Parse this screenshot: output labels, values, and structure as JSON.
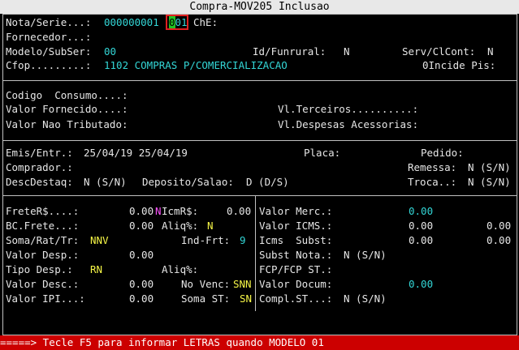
{
  "window": {
    "title": "Compra-MOV205  Inclusao"
  },
  "header": {
    "nota_serie_label": "Nota/Serie...:",
    "nota_value": "000000001",
    "serie_cursor_char": "0",
    "serie_rest": "01",
    "che_label": "ChE:",
    "fornecedor_label": "Fornecedor...:",
    "modelo_label": "Modelo/SubSer:",
    "modelo_value": "00",
    "idfunrural_label": "Id/Funrural:",
    "idfunrural_value": "N",
    "servclcont_label": "Serv/ClCont:",
    "servclcont_value": "N",
    "cfop_label": "Cfop.........:",
    "cfop_value": "1102 COMPRAS P/COMERCIALIZACAO",
    "incide_pis_label": "0Incide Pis:"
  },
  "values_section": {
    "codigo_consumo_label": "Codigo  Consumo....:",
    "valor_fornecido_label": "Valor Fornecido....:",
    "vl_terceiros_label": "Vl.Terceiros..........:",
    "valor_nao_tributado_label": "Valor Nao Tributado:",
    "vl_despesas_label": "Vl.Despesas Acessorias:"
  },
  "dates_section": {
    "emis_entr_label": "Emis/Entr.:",
    "emis_entr_value": "25/04/19 25/04/19",
    "placa_label": "Placa:",
    "pedido_label": "Pedido:",
    "comprador_label": "Comprador.:",
    "remessa_label": "Remessa:",
    "remessa_value": "N (S/N)",
    "descdestaq_label": "DescDestaq:",
    "descdestaq_value": "N (S/N)",
    "deposito_label": "Deposito/Salao:",
    "deposito_value": "D (D/S)",
    "troca_label": "Troca..:",
    "troca_value": "N (S/N)"
  },
  "left_panel": {
    "frete_label": "FreteR$....:",
    "frete_value": "0.00",
    "frete_flag": "N",
    "icmr_label": "IcmR$:",
    "icmr_value": "0.00",
    "bcfrete_label": "BC.Frete...:",
    "bcfrete_value": "0.00",
    "aliq_label": "Aliq%:",
    "aliq_value": "N",
    "soma_label": "Soma/Rat/Tr:",
    "soma_value": "NNV",
    "indfrt_label": "Ind-Frt:",
    "indfrt_value": "9",
    "valor_desp_label": "Valor Desp.:",
    "valor_desp_value": "0.00",
    "tipo_desp_label": "Tipo Desp.:",
    "tipo_desp_value": "RN",
    "aliq2_label": "Aliq%:",
    "valor_desc_label": "Valor Desc.:",
    "valor_desc_value": "0.00",
    "novenc_label": "No Venc:",
    "novenc_value": "SNN",
    "valor_ipi_label": "Valor IPI...:",
    "valor_ipi_value": "0.00",
    "somast_label": "Soma ST:",
    "somast_value": "SN"
  },
  "right_panel": {
    "valor_merc_label": "Valor Merc.:",
    "valor_merc_value": "0.00",
    "valor_icms_label": "Valor ICMS.:",
    "valor_icms_value": "0.00",
    "valor_icms_value2": "0.00",
    "icms_subst_label": "Icms  Subst:",
    "icms_subst_value": "0.00",
    "icms_subst_value2": "0.00",
    "subst_nota_label": "Subst Nota.:",
    "subst_nota_value": "N (S/N)",
    "fcp_label": "FCP/FCP ST.:",
    "valor_docum_label": "Valor Docum:",
    "valor_docum_value": "0.00",
    "compl_st_label": "Compl.ST...:",
    "compl_st_value": "N (S/N)"
  },
  "status_bar": {
    "message": "=====> Tecle F5 para informar LETRAS quando MODELO 01"
  },
  "colors": {
    "background": "#000000",
    "label": "#e6e6e6",
    "value": "#33d6d6",
    "flag": "#f5f546",
    "alert": "#cc0000",
    "cursor": "#22c122"
  }
}
